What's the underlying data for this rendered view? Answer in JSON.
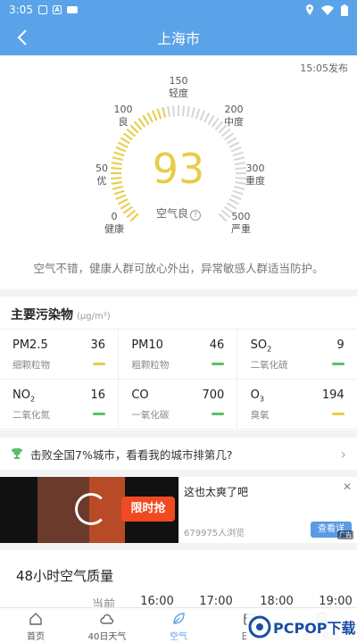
{
  "status": {
    "time": "3:05",
    "a_badge": "A"
  },
  "nav": {
    "title": "上海市"
  },
  "publish_time": "15:05发布",
  "gauge": {
    "value": "93",
    "level": "空气良",
    "fill_fraction": 0.46,
    "labels": [
      {
        "num": "0",
        "text": "健康"
      },
      {
        "num": "50",
        "text": "优"
      },
      {
        "num": "100",
        "text": "良"
      },
      {
        "num": "150",
        "text": "轻度"
      },
      {
        "num": "200",
        "text": "中度"
      },
      {
        "num": "300",
        "text": "重度"
      },
      {
        "num": "500",
        "text": "严重"
      }
    ],
    "accent": "#e8cc48"
  },
  "advice": "空气不错，健康人群可放心外出，异常敏感人群适当防护。",
  "pollutants": {
    "title": "主要污染物",
    "unit": "(μg/m³)",
    "items": [
      {
        "name": "PM2.5",
        "sub": "",
        "value": "36",
        "desc": "细颗粒物",
        "color": "#e8cc48"
      },
      {
        "name": "PM10",
        "sub": "",
        "value": "46",
        "desc": "粗颗粒物",
        "color": "#5cbf6a"
      },
      {
        "name": "SO",
        "sub": "2",
        "value": "9",
        "desc": "二氧化硫",
        "color": "#5cbf6a"
      },
      {
        "name": "NO",
        "sub": "2",
        "value": "16",
        "desc": "二氧化氮",
        "color": "#5cbf6a"
      },
      {
        "name": "CO",
        "sub": "",
        "value": "700",
        "desc": "一氧化碳",
        "color": "#5cbf6a"
      },
      {
        "name": "O",
        "sub": "3",
        "value": "194",
        "desc": "臭氧",
        "color": "#e8cc48"
      }
    ]
  },
  "rank": {
    "text": "击败全国7%城市，看看我的城市排第几?"
  },
  "ad": {
    "title": "这也太爽了吧",
    "views": "679975人浏览",
    "banner": "限时抢",
    "button": "查看详",
    "tag": "广告"
  },
  "hourly": {
    "title": "48小时空气质量",
    "times": [
      "当前",
      "16:00",
      "17:00",
      "18:00",
      "19:00"
    ]
  },
  "tabs": [
    {
      "label": "首页",
      "icon": "home-icon"
    },
    {
      "label": "40日天气",
      "icon": "cloud-icon"
    },
    {
      "label": "空气",
      "icon": "leaf-icon"
    },
    {
      "label": "日历",
      "icon": "calendar-icon"
    },
    {
      "label": "热点资讯",
      "icon": "news-icon"
    }
  ],
  "watermark": "PCPOP下载"
}
